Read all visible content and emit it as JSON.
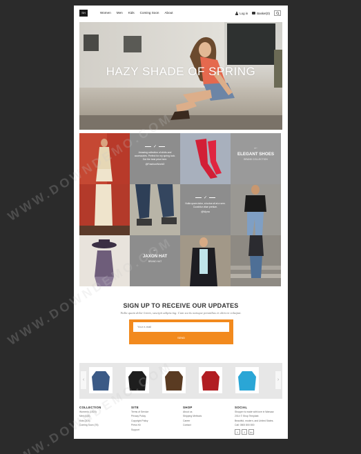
{
  "header": {
    "logo_text": "SH",
    "nav": [
      "Women",
      "Men",
      "Kids",
      "Coming Soon",
      "About"
    ],
    "login": "Log in",
    "basket": "Basket(0)"
  },
  "hero": {
    "title": "HAZY SHADE OF SPRING"
  },
  "tiles": {
    "tweet1": {
      "text": "Amazing collection of shirts and accessories. Perfect for my spring look. Got the best price here.",
      "handle": "@FashionWorld2"
    },
    "product1": {
      "name": "ELEGANT SHOES",
      "sub": "BRAND COLLECTION"
    },
    "tweet2": {
      "text": "Nulla quam dolor, a luctus sit at a sem. Curabitur vitae pretium.",
      "handle": "@Myna"
    },
    "product2": {
      "name": "JAXON HAT",
      "sub": "BRAND HAT"
    }
  },
  "signup": {
    "title": "SIGN UP TO RECEIVE OUR UPDATES",
    "subtitle": "Nulla quam dolor lorem, suscipit adipiscing. Cum sociis natoque penatibus et ultrices volutpat.",
    "email_placeholder": "Your e-mail",
    "send_label": "SEND"
  },
  "carousel": {
    "products": [
      {
        "color": "#3b5a86"
      },
      {
        "color": "#1e1e1e"
      },
      {
        "color": "#5a3b22"
      },
      {
        "color": "#b11d22"
      },
      {
        "color": "#2aa6d6"
      }
    ]
  },
  "footer": {
    "columns": [
      {
        "heading": "COLLECTION",
        "links": [
          "Women's (1520)",
          "Men (438)",
          "Kids (203)",
          "Coming Soon (76)"
        ]
      },
      {
        "heading": "SITE",
        "links": [
          "Terms of Service",
          "Privacy Policy",
          "Copyright Policy",
          "Press Kit",
          "Support"
        ]
      },
      {
        "heading": "SHOP",
        "links": [
          "About us",
          "Shipping Methods",
          "Career",
          "Contact"
        ]
      },
      {
        "heading": "SOCIAL",
        "links": [
          "Shopper is made with love in Warsaw.",
          "2014 © Shop Template.",
          "Beautiful, modern, and United States.",
          "Call: 0800 800 800"
        ]
      }
    ],
    "social_icons": [
      "t",
      "f",
      "in"
    ]
  },
  "watermark": "WWW.DOWNDEMO.COM"
}
